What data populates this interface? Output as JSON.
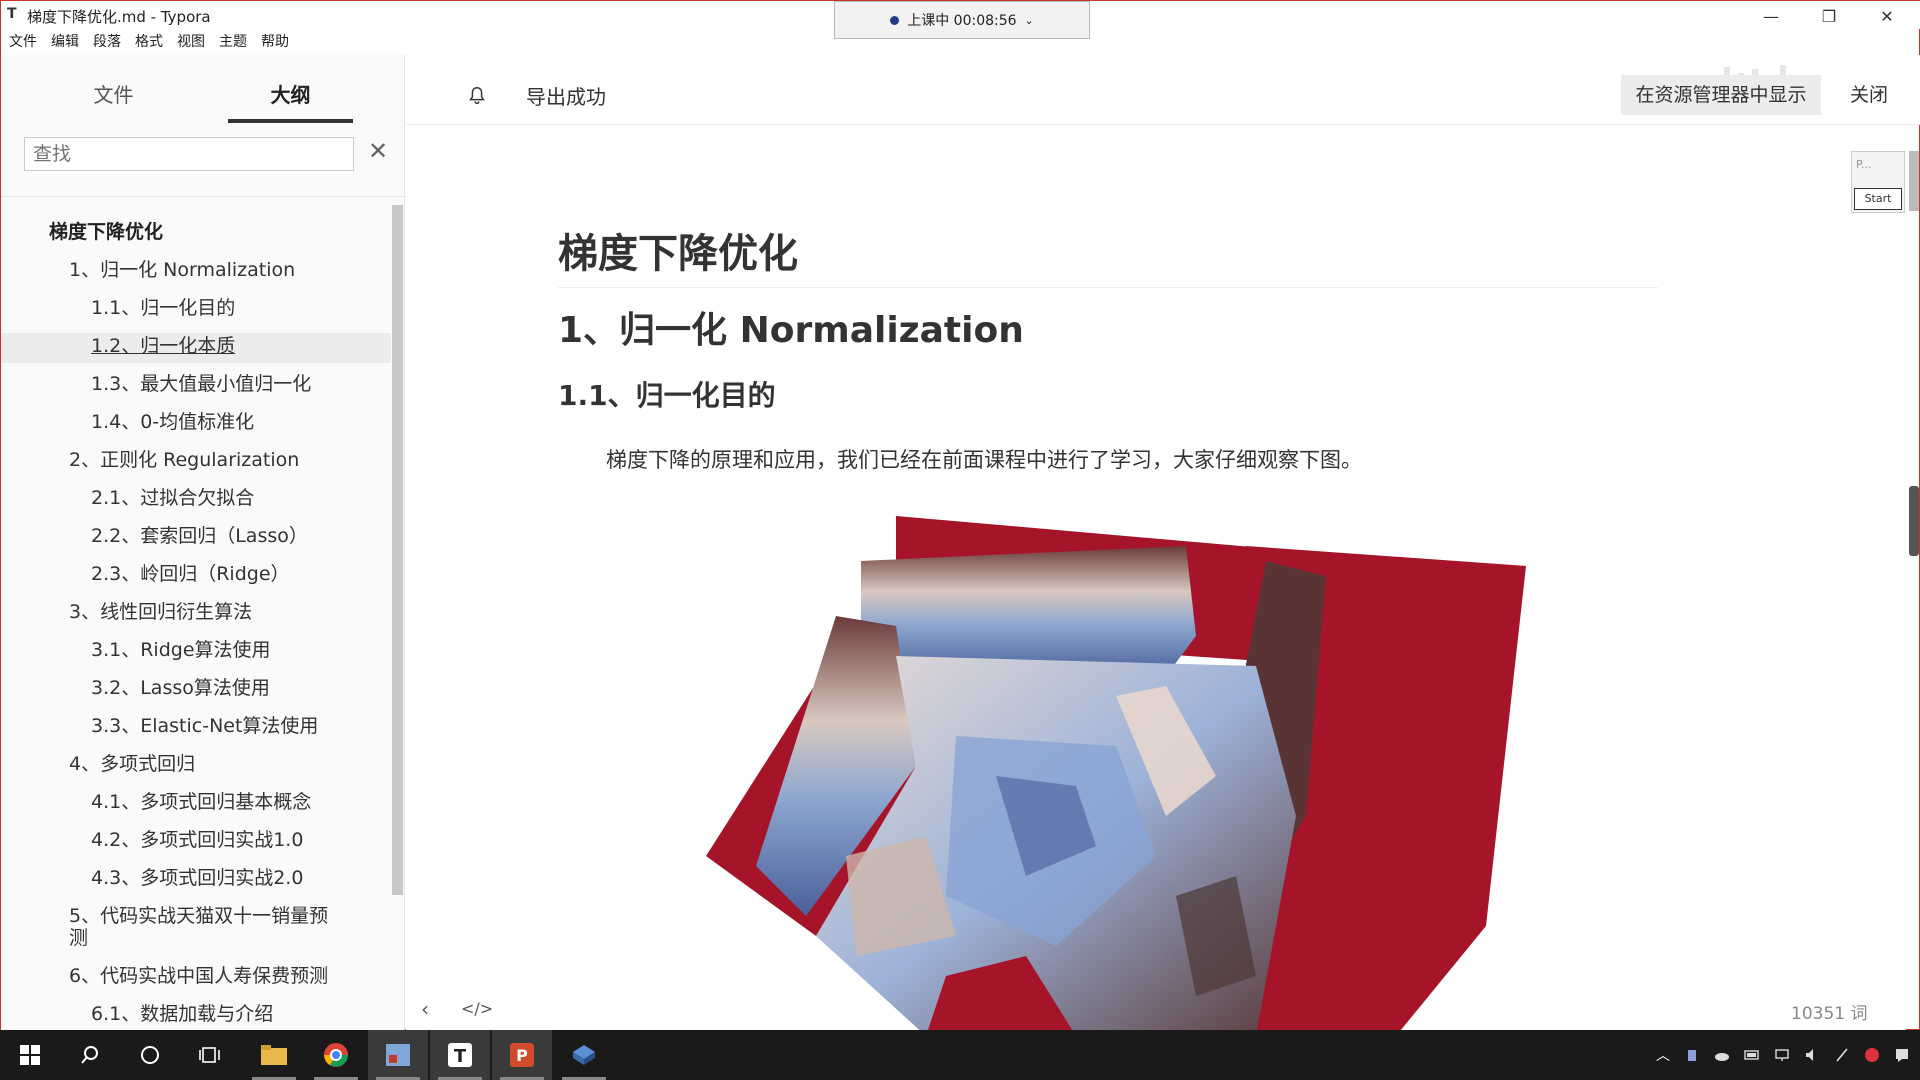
{
  "window": {
    "title": "梯度下降优化.md - Typora",
    "app_icon": "T",
    "recording": {
      "label": "上课中 00:08:56"
    }
  },
  "menu": [
    "文件",
    "编辑",
    "段落",
    "格式",
    "视图",
    "主题",
    "帮助"
  ],
  "sidebar": {
    "tabs": [
      "文件",
      "大纲"
    ],
    "active_tab": "大纲",
    "search_placeholder": "查找",
    "outline": [
      {
        "label": "梯度下降优化",
        "level": 0
      },
      {
        "label": "1、归一化 Normalization",
        "level": 1
      },
      {
        "label": "1.1、归一化目的",
        "level": 2
      },
      {
        "label": "1.2、归一化本质",
        "level": 2,
        "hover": true
      },
      {
        "label": "1.3、最大值最小值归一化",
        "level": 2
      },
      {
        "label": "1.4、0-均值标准化",
        "level": 2
      },
      {
        "label": "2、正则化 Regularization",
        "level": 1
      },
      {
        "label": "2.1、过拟合欠拟合",
        "level": 2
      },
      {
        "label": "2.2、套索回归（Lasso）",
        "level": 2
      },
      {
        "label": "2.3、岭回归（Ridge）",
        "level": 2
      },
      {
        "label": "3、线性回归衍生算法",
        "level": 1
      },
      {
        "label": "3.1、Ridge算法使用",
        "level": 2
      },
      {
        "label": "3.2、Lasso算法使用",
        "level": 2
      },
      {
        "label": "3.3、Elastic-Net算法使用",
        "level": 2
      },
      {
        "label": "4、多项式回归",
        "level": 1
      },
      {
        "label": "4.1、多项式回归基本概念",
        "level": 2
      },
      {
        "label": "4.2、多项式回归实战1.0",
        "level": 2
      },
      {
        "label": "4.3、多项式回归实战2.0",
        "level": 2
      },
      {
        "label": "5、代码实战天猫双十一销量预",
        "level": 1
      },
      {
        "label": "测",
        "level": 1,
        "continuation": true
      },
      {
        "label": "6、代码实战中国人寿保费预测",
        "level": 1
      },
      {
        "label": "6.1、数据加载与介绍",
        "level": 2
      }
    ]
  },
  "header": {
    "notice": "导出成功",
    "show_in_explorer": "在资源管理器中显示",
    "close": "关闭"
  },
  "document": {
    "h1": "梯度下降优化",
    "h2": "1、归一化 Normalization",
    "h3": "1.1、归一化目的",
    "paragraph": "梯度下降的原理和应用，我们已经在前面课程中进行了学习，大家仔细观察下图。"
  },
  "mini_widget": {
    "label": "P...",
    "button": "Start"
  },
  "footer": {
    "word_count": "10351 词"
  },
  "taskbar": {
    "items": [
      "start-icon",
      "search-icon",
      "cortana-icon",
      "task-view-icon",
      "file-explorer-icon",
      "chrome-icon",
      "paint-icon",
      "typora-icon",
      "powerpoint-icon",
      "app-icon"
    ]
  }
}
